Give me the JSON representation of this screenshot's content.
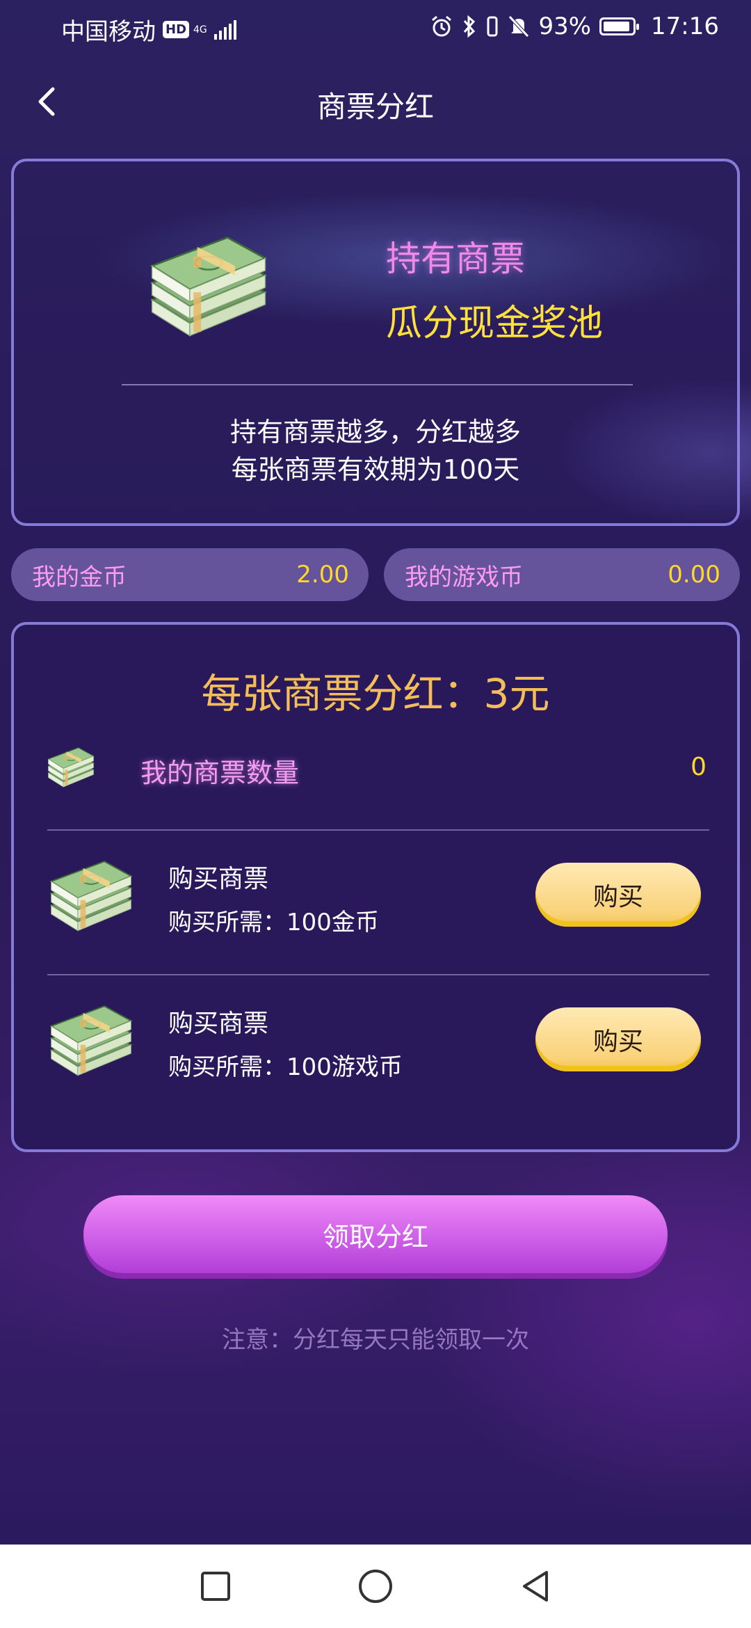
{
  "status_bar": {
    "carrier": "中国移动",
    "hd": "HD",
    "network": "4G",
    "battery_percent": "93%",
    "battery_level": 0.93,
    "time": "17:16",
    "icons": [
      "alarm-icon",
      "bluetooth-icon",
      "vibrate-icon",
      "mute-icon",
      "battery-icon"
    ]
  },
  "header": {
    "title": "商票分红",
    "back_icon": "chevron-left-icon"
  },
  "intro": {
    "line1": "持有商票",
    "line2": "瓜分现金奖池",
    "desc1": "持有商票越多，分红越多",
    "desc2": "每张商票有效期为100天"
  },
  "balances": {
    "gold": {
      "label": "我的金币",
      "value": "2.00"
    },
    "game": {
      "label": "我的游戏币",
      "value": "0.00"
    }
  },
  "main": {
    "dividend_title": "每张商票分红：3元",
    "count_label": "我的商票数量",
    "count_value": "0",
    "buy_options": [
      {
        "title": "购买商票",
        "cost": "购买所需：100金币",
        "button": "购买"
      },
      {
        "title": "购买商票",
        "cost": "购买所需：100游戏币",
        "button": "购买"
      }
    ]
  },
  "claim": {
    "button": "领取分红",
    "notice": "注意：分红每天只能领取一次"
  },
  "colors": {
    "background": "#2a1b5c",
    "accent_pink": "#f08ae8",
    "accent_yellow": "#ffe03c",
    "gold_title": "#f3bd5a",
    "buy_button": "#f9d27a",
    "claim_button": "#cb5ce6"
  },
  "nav": {
    "recent_icon": "square-icon",
    "home_icon": "circle-icon",
    "back_icon": "triangle-back-icon"
  }
}
